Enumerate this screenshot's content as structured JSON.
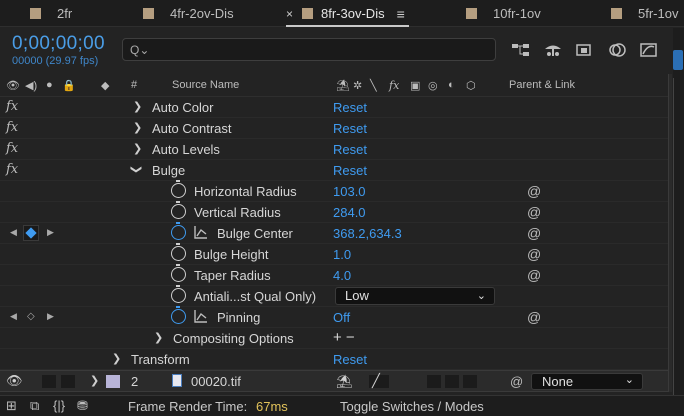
{
  "tabs": [
    {
      "label": "2fr"
    },
    {
      "label": "4fr-2ov-Dis"
    },
    {
      "label": "8fr-3ov-Dis",
      "active": true
    },
    {
      "label": "10fr-1ov"
    },
    {
      "label": "5fr-1ov"
    }
  ],
  "tab_close": "×",
  "tab_menu": "≡",
  "header": {
    "timecode": "0;00;00;00",
    "frames": "00000 (29.97 fps)",
    "search_value": "Q⌄"
  },
  "columns": {
    "num": "#",
    "source_name": "Source Name",
    "parent_link": "Parent & Link"
  },
  "colors": {
    "accent": "#3f9bf0",
    "tab_swatch": "#b59e80",
    "layer_swatch": "#b8b4d8"
  },
  "effects": [
    {
      "name": "Auto Color",
      "value": "Reset",
      "expanded": false
    },
    {
      "name": "Auto Contrast",
      "value": "Reset",
      "expanded": false
    },
    {
      "name": "Auto Levels",
      "value": "Reset",
      "expanded": false
    },
    {
      "name": "Bulge",
      "value": "Reset",
      "expanded": true
    }
  ],
  "properties": [
    {
      "name": "Horizontal Radius",
      "value": "103.0"
    },
    {
      "name": "Vertical Radius",
      "value": "284.0"
    },
    {
      "name": "Bulge Center",
      "value": "368.2,634.3"
    },
    {
      "name": "Bulge Height",
      "value": "1.0"
    },
    {
      "name": "Taper Radius",
      "value": "4.0"
    },
    {
      "name": "Antiali...st Qual Only)",
      "value": "Low"
    },
    {
      "name": "Pinning",
      "value": "Off"
    }
  ],
  "compositing": {
    "name": "Compositing Options",
    "value": "+ −"
  },
  "transform": {
    "name": "Transform",
    "value": "Reset"
  },
  "layer": {
    "number": "2",
    "name": "00020.tif",
    "parent": "None"
  },
  "footer": {
    "render_label": "Frame Render Time:",
    "render_value": "67ms",
    "toggle": "Toggle Switches / Modes"
  }
}
